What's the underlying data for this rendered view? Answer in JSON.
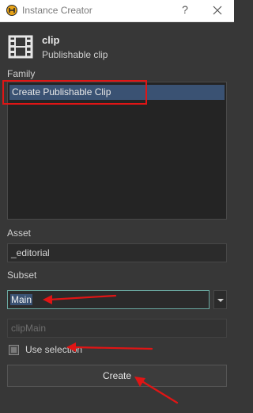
{
  "window": {
    "title": "Instance Creator",
    "help_label": "?"
  },
  "family_header": {
    "name": "clip",
    "description": "Publishable clip",
    "icon": "film-icon"
  },
  "family": {
    "label": "Family",
    "items": [
      {
        "label": "Create Publishable Clip",
        "selected": true
      }
    ]
  },
  "asset": {
    "label": "Asset",
    "value": "_editorial"
  },
  "subset": {
    "label": "Subset",
    "value": "Main"
  },
  "preview": {
    "value": "clipMain"
  },
  "use_selection": {
    "label": "Use selection",
    "checked": false
  },
  "create_button": {
    "label": "Create"
  },
  "annotations": {
    "color": "#e01515"
  }
}
